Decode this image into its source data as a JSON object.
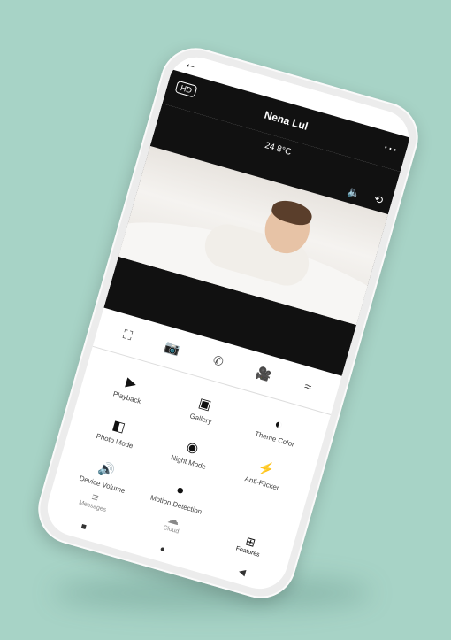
{
  "app": {
    "title": "Nena Lul",
    "hd_label": "HD",
    "temperature": "24.8°C"
  },
  "controls": [
    {
      "icon": "scan-icon",
      "glyph": "⛶"
    },
    {
      "icon": "camera-icon",
      "glyph": "📷"
    },
    {
      "icon": "phone-icon",
      "glyph": "✆"
    },
    {
      "icon": "video-icon",
      "glyph": "🎥"
    },
    {
      "icon": "more-icon",
      "glyph": "≈"
    }
  ],
  "features": [
    {
      "label": "Playback",
      "icon": "play-icon",
      "glyph": "▶"
    },
    {
      "label": "Gallery",
      "icon": "gallery-icon",
      "glyph": "▣"
    },
    {
      "label": "Theme Color",
      "icon": "palette-icon",
      "glyph": "◐"
    },
    {
      "label": "Photo Mode",
      "icon": "photo-mode-icon",
      "glyph": "◧"
    },
    {
      "label": "Night Mode",
      "icon": "night-icon",
      "glyph": "◉"
    },
    {
      "label": "Anti-Flicker",
      "icon": "flicker-icon",
      "glyph": "⚡"
    },
    {
      "label": "Device Volume",
      "icon": "volume-icon",
      "glyph": "🔊"
    },
    {
      "label": "Motion Detection",
      "icon": "motion-icon",
      "glyph": "●"
    }
  ],
  "nav": [
    {
      "label": "Messages",
      "icon": "messages-icon",
      "glyph": "≡"
    },
    {
      "label": "Cloud",
      "icon": "cloud-icon",
      "glyph": "☁"
    },
    {
      "label": "Features",
      "icon": "features-icon",
      "glyph": "⊞"
    }
  ],
  "colors": {
    "background": "#a7d3c6",
    "header": "#111111"
  }
}
